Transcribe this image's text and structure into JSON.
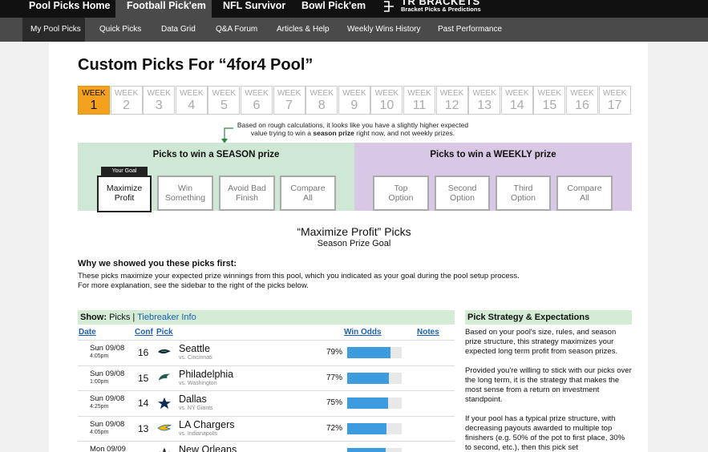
{
  "topnav": {
    "tabs": [
      "Pool Picks Home",
      "Football Pick'em",
      "NFL Survivor",
      "Bowl Pick'em"
    ],
    "logo_main": "TR BRACKETS",
    "logo_sub": "Bracket Picks & Predictions"
  },
  "subnav": {
    "items": [
      "My Pool Picks",
      "Quick Picks",
      "Data Grid",
      "Q&A Forum",
      "Articles & Help",
      "Weekly Wins History",
      "Past Performance"
    ]
  },
  "page": {
    "title": "Custom Picks For “4for4 Pool”",
    "week_label": "WEEK",
    "weeks": [
      "1",
      "2",
      "3",
      "4",
      "5",
      "6",
      "7",
      "8",
      "9",
      "10",
      "11",
      "12",
      "13",
      "14",
      "15",
      "16",
      "17"
    ],
    "note_pre": "Based on rough calculations, it looks like you have a slightly higher expected value trying to win a ",
    "note_bold": "season prize",
    "note_post": " right now, and not weekly prizes.",
    "season_heading": "Picks to win a SEASON prize",
    "weekly_heading": "Picks to win a WEEKLY prize",
    "goal_tag": "Your Goal",
    "season_options": [
      [
        "Maximize",
        "Profit"
      ],
      [
        "Win",
        "Something"
      ],
      [
        "Avoid Bad",
        "Finish"
      ],
      [
        "Compare",
        "All"
      ]
    ],
    "weekly_options": [
      [
        "Top",
        "Option"
      ],
      [
        "Second",
        "Option"
      ],
      [
        "Third",
        "Option"
      ],
      [
        "Compare",
        "All"
      ]
    ],
    "section_title": "“Maximize Profit” Picks",
    "section_sub": "Season Prize Goal",
    "why_heading": "Why we showed you these picks first:",
    "why_line1": "These picks maximize your expected prize winnings from this pool, which you indicated as your goal during the pool setup process.",
    "why_line2": "For more explanation, see the sidebar to the right of the picks below."
  },
  "picks_table": {
    "show_label": "Show:",
    "show_picks": "Picks",
    "show_sep": "|",
    "show_tiebreaker": "Tiebreaker Info",
    "headers": {
      "date": "Date",
      "conf": "Conf",
      "pick": "Pick",
      "win_odds": "Win Odds",
      "notes": "Notes"
    },
    "rows": [
      {
        "date": "Sun 09/08",
        "time": "4:05pm",
        "conf": "16",
        "team": "Seattle",
        "vs": "vs. Cincinnati",
        "pct": "79%",
        "odds": 0.79,
        "logo": "seahawks-logo-icon",
        "color": "#0b2a4a"
      },
      {
        "date": "Sun 09/08",
        "time": "1:00pm",
        "conf": "15",
        "team": "Philadelphia",
        "vs": "vs. Washington",
        "pct": "77%",
        "odds": 0.77,
        "logo": "eagles-logo-icon",
        "color": "#1d5c4f"
      },
      {
        "date": "Sun 09/08",
        "time": "4:25pm",
        "conf": "14",
        "team": "Dallas",
        "vs": "vs. NY Giants",
        "pct": "75%",
        "odds": 0.75,
        "logo": "cowboys-star-icon",
        "color": "#0b2a5a"
      },
      {
        "date": "Sun 09/08",
        "time": "4:05pm",
        "conf": "13",
        "team": "LA Chargers",
        "vs": "vs. Indianapolis",
        "pct": "72%",
        "odds": 0.72,
        "logo": "chargers-bolt-icon",
        "color": "#f2b800"
      },
      {
        "date": "Mon 09/09",
        "time": "",
        "conf": "",
        "team": "New Orleans",
        "vs": "",
        "pct": "",
        "odds": 0.7,
        "logo": "saints-fleur-icon",
        "color": "#333"
      }
    ]
  },
  "sidebar": {
    "heading": "Pick Strategy & Expectations",
    "paragraphs": [
      "Based on your pool's size, rules, and season prize structure, this strategy maximizes your expected long term profit from season prizes.",
      "Provided you're willing to stick with our picks over the long term, it is the strategy that makes the most sense from a return on investment standpoint.",
      "If your pool has a typical prize structure, with decreasing payouts awarded to multiple top finishers (e.g. 50% of the pot to first place, 30% to second, etc.), then this pick set"
    ]
  },
  "colors": {
    "accent_orange": "#f4a11f",
    "season_green": "#cfe8d5",
    "weekly_purple": "#d8c8e6",
    "bar_blue": "#3d9be0",
    "link_blue": "#1a5fb4"
  }
}
